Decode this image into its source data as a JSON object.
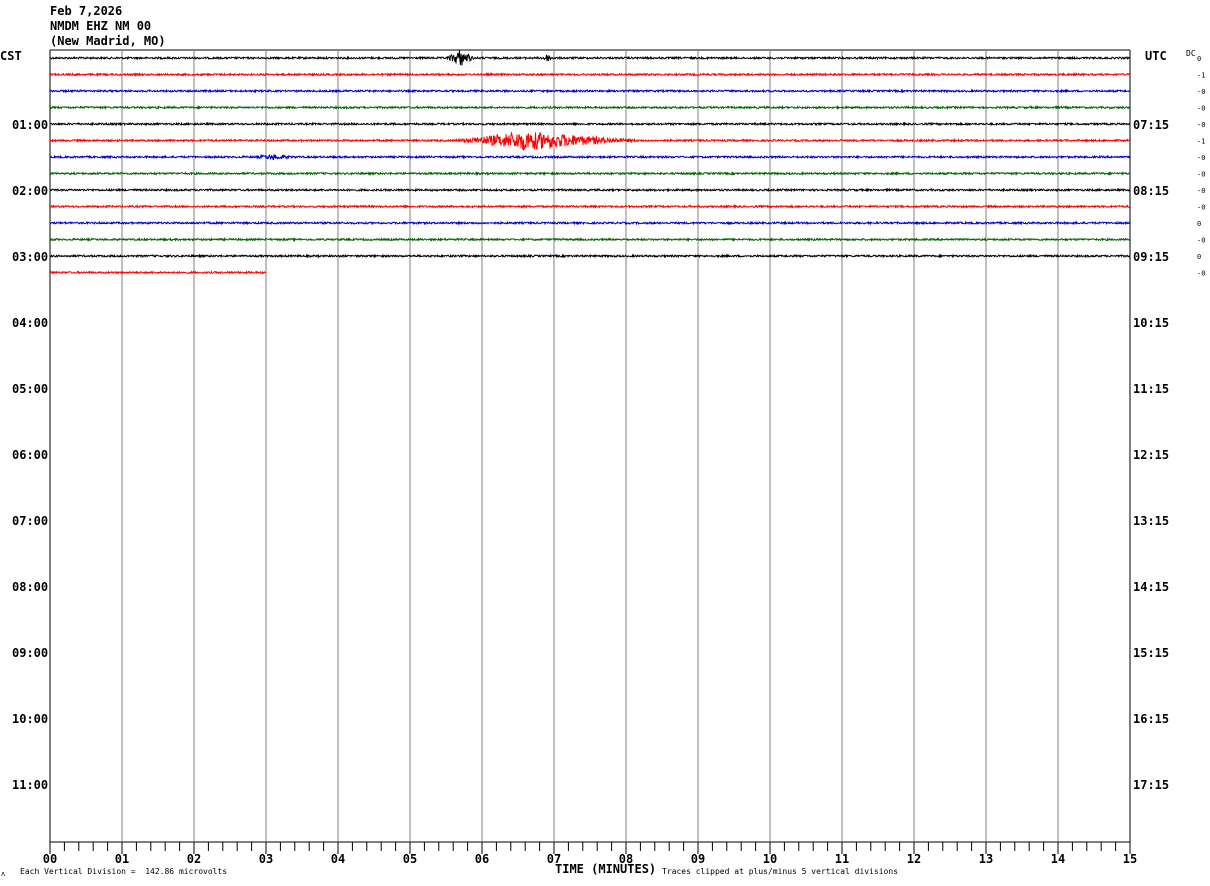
{
  "header": {
    "date": "Feb 7,2026",
    "station": "NMDM EHZ NM 00",
    "location": "(New Madrid, MO)"
  },
  "left_axis_label": "CST",
  "right_axis_label": "UTC",
  "dc_label": "DC",
  "footer": {
    "mark": "ʌ",
    "scale_note": "Each Vertical Division =  142.86 microvolts",
    "x_title": "TIME (MINUTES)",
    "clip_note": "Traces clipped at plus/minus 5 vertical divisions"
  },
  "colors": {
    "cycle": [
      "#000000",
      "#ff0000",
      "#0000cc",
      "#006400"
    ],
    "grid": "#808080"
  },
  "chart_data": {
    "type": "line",
    "title": "",
    "xlabel": "TIME (MINUTES)",
    "xlim": [
      0,
      15
    ],
    "x_ticks": [
      "00",
      "01",
      "02",
      "03",
      "04",
      "05",
      "06",
      "07",
      "08",
      "09",
      "10",
      "11",
      "12",
      "13",
      "14",
      "15"
    ],
    "cst_hour_labels": [
      "01:00",
      "02:00",
      "03:00",
      "04:00",
      "05:00",
      "06:00",
      "07:00",
      "08:00",
      "09:00",
      "10:00",
      "11:00"
    ],
    "utc_hour_labels": [
      "07:15",
      "08:15",
      "09:15",
      "10:15",
      "11:15",
      "12:15",
      "13:15",
      "14:15",
      "15:15",
      "16:15",
      "17:15"
    ],
    "dc_offsets": [
      "0",
      "-1",
      "-0",
      "-0",
      "-0",
      "-1",
      "-0",
      "-0",
      "-0",
      "-0",
      "0",
      "-0",
      "0",
      "-0"
    ],
    "traces": [
      {
        "row": 0,
        "end_minute": 15,
        "events": [
          {
            "start": 5.5,
            "end": 5.9,
            "amp": 8
          },
          {
            "start": 6.8,
            "end": 7.0,
            "amp": 3
          }
        ]
      },
      {
        "row": 1,
        "end_minute": 15,
        "events": []
      },
      {
        "row": 2,
        "end_minute": 15,
        "events": []
      },
      {
        "row": 3,
        "end_minute": 15,
        "events": []
      },
      {
        "row": 4,
        "end_minute": 15,
        "events": []
      },
      {
        "row": 5,
        "end_minute": 15,
        "events": [
          {
            "start": 5.6,
            "end": 8.2,
            "amp": 9,
            "peak": 6.6
          }
        ]
      },
      {
        "row": 6,
        "end_minute": 15,
        "events": [
          {
            "start": 2.8,
            "end": 3.4,
            "amp": 2
          }
        ]
      },
      {
        "row": 7,
        "end_minute": 15,
        "events": []
      },
      {
        "row": 8,
        "end_minute": 15,
        "events": []
      },
      {
        "row": 9,
        "end_minute": 15,
        "events": []
      },
      {
        "row": 10,
        "end_minute": 15,
        "events": []
      },
      {
        "row": 11,
        "end_minute": 15,
        "events": []
      },
      {
        "row": 12,
        "end_minute": 15,
        "events": []
      },
      {
        "row": 13,
        "end_minute": 3,
        "events": []
      }
    ]
  }
}
